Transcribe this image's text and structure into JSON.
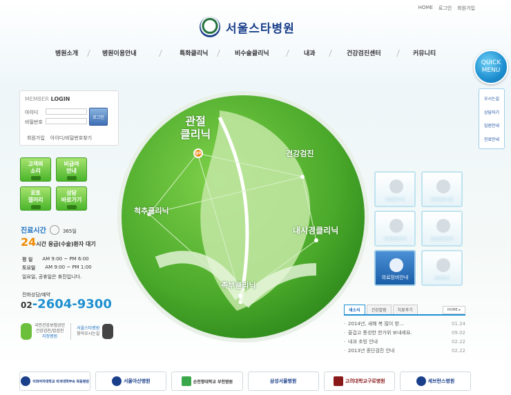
{
  "toplinks": [
    "HOME",
    "로그인",
    "회원가입"
  ],
  "logo": "서울스타병원",
  "nav": [
    "병원소개",
    "병원이용안내",
    "특화클리닉",
    "비수술클리닉",
    "내과",
    "건강검진센터",
    "커뮤니티"
  ],
  "quick": {
    "title1": "QUICK",
    "title2": "MENU",
    "items": [
      "오시는길",
      "상담하기",
      "입원안내",
      "진료안내"
    ]
  },
  "login": {
    "title_a": "MEMBER",
    "title_b": "LOGIN",
    "id_label": "아이디",
    "pw_label": "비밀번호",
    "button": "로그인",
    "join": "회원가입",
    "find": "아이디/비밀번호찾기"
  },
  "greenbtns": [
    [
      "고객의",
      "소리"
    ],
    [
      "비급여",
      "안내"
    ],
    [
      "포토",
      "갤러리"
    ],
    [
      "상담",
      "바로가기"
    ]
  ],
  "hours": {
    "title": "진료시간",
    "days": "365일",
    "big": "24",
    "sub": "시간 응급(수술)환자 대기",
    "weekday_l": "평 일",
    "weekday": "AM 9:00 ~ PM 6:00",
    "sat_l": "토요일",
    "sat": "AM 9:00 ~ PM 1:00",
    "note": "일요일, 공휴일은 휴진입니다.",
    "tel_label": "전화상담/예약",
    "tel_a": "02",
    "tel_b": "-2604-9300"
  },
  "bottomleft": {
    "a1": "국민건강보험공단",
    "a2": "건강검진/암검진",
    "a3": "지정병원",
    "b1": "서울스타병원",
    "b2": "찾아오시는길"
  },
  "clinics": {
    "joint1": "관절",
    "joint2": "클리닉",
    "go": "go",
    "health": "건강검진",
    "spine": "척추클리닉",
    "endo": "내시경클리닉",
    "foot": "족부클리닉"
  },
  "tiles": [
    "의료진소개",
    "외래진료시간",
    "의료진단안내",
    "입원진료안내",
    "의료장비안내",
    "증명안내"
  ],
  "news": {
    "tabs": [
      "새소식",
      "건강칼럼",
      "치료후기"
    ],
    "more": "HOME ▸",
    "items": [
      {
        "t": "2014년, 새해 복 많이 받...",
        "d": "01.24"
      },
      {
        "t": "즐겁고 풍성한 한가위 보내세요.",
        "d": "09.02"
      },
      {
        "t": "내과 초빙 안내",
        "d": "02.22"
      },
      {
        "t": "2013년 종단검진 안내",
        "d": "02.22"
      }
    ]
  },
  "partners": [
    "이화여자대학교 의과대학부속 목동병원",
    "서울아산병원",
    "순천향대학교 부천병원",
    "삼성서울병원",
    "고려대학교구로병원",
    "세브란스병원"
  ]
}
